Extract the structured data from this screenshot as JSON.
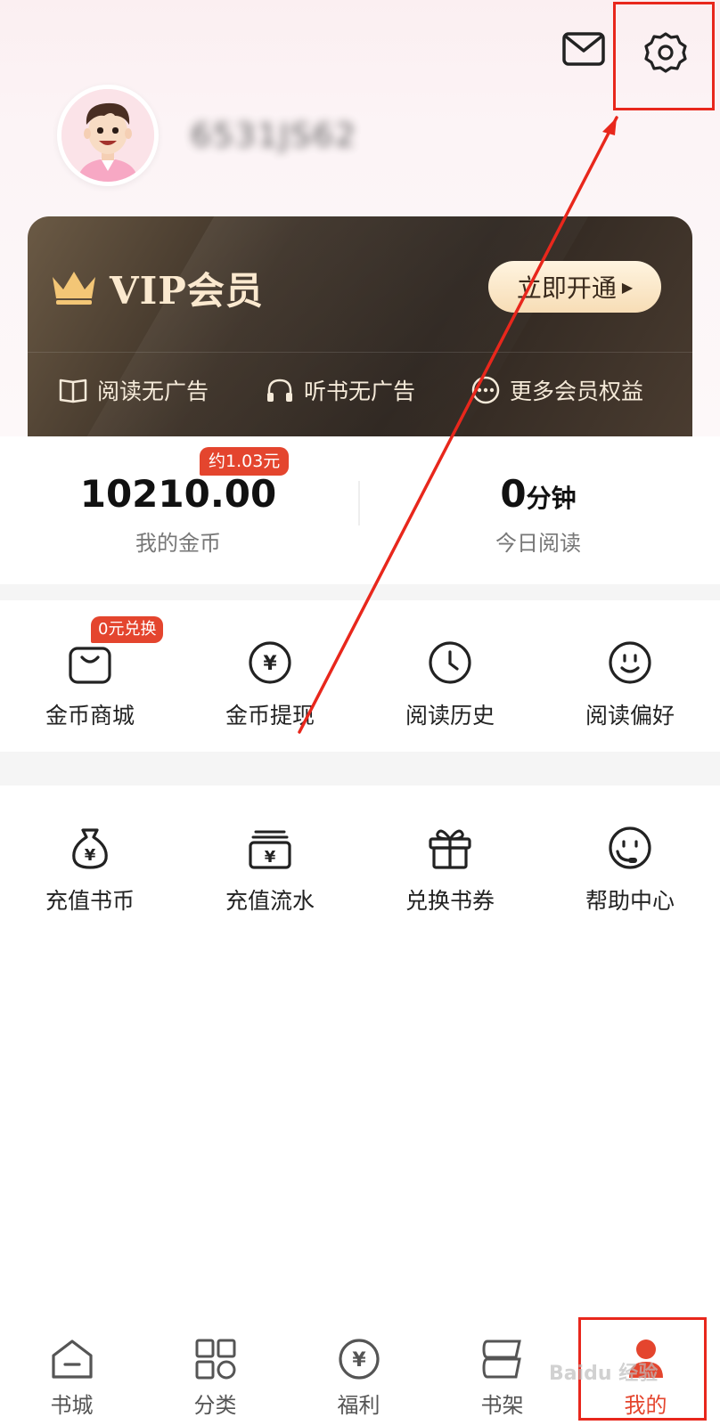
{
  "header": {
    "username": "6531JS62"
  },
  "vip": {
    "title": "VIP会员",
    "open_button": "立即开通",
    "benefits": [
      "阅读无广告",
      "听书无广告",
      "更多会员权益"
    ]
  },
  "stats": {
    "coins": {
      "value": "10210.00",
      "label": "我的金币",
      "badge": "约1.03元"
    },
    "reading": {
      "value": "0",
      "unit": "分钟",
      "label": "今日阅读"
    }
  },
  "grid1": [
    {
      "label": "金币商城",
      "icon": "bag-icon",
      "badge": "0元兑换"
    },
    {
      "label": "金币提现",
      "icon": "yen-coin-icon"
    },
    {
      "label": "阅读历史",
      "icon": "clock-icon"
    },
    {
      "label": "阅读偏好",
      "icon": "smiley-icon"
    }
  ],
  "grid2": [
    {
      "label": "充值书币",
      "icon": "money-bag-icon"
    },
    {
      "label": "充值流水",
      "icon": "yen-wallet-icon"
    },
    {
      "label": "兑换书券",
      "icon": "gift-icon"
    },
    {
      "label": "帮助中心",
      "icon": "headset-icon"
    }
  ],
  "tabbar": [
    {
      "label": "书城",
      "icon": "home-icon"
    },
    {
      "label": "分类",
      "icon": "grid-icon"
    },
    {
      "label": "福利",
      "icon": "yen-coin-icon"
    },
    {
      "label": "书架",
      "icon": "bookshelf-icon"
    },
    {
      "label": "我的",
      "icon": "user-icon",
      "active": true
    }
  ],
  "colors": {
    "accent": "#e4452e",
    "annotation": "#e8271c",
    "vip_gold": "#fbe9cf"
  },
  "watermark": "Baidu 经验"
}
